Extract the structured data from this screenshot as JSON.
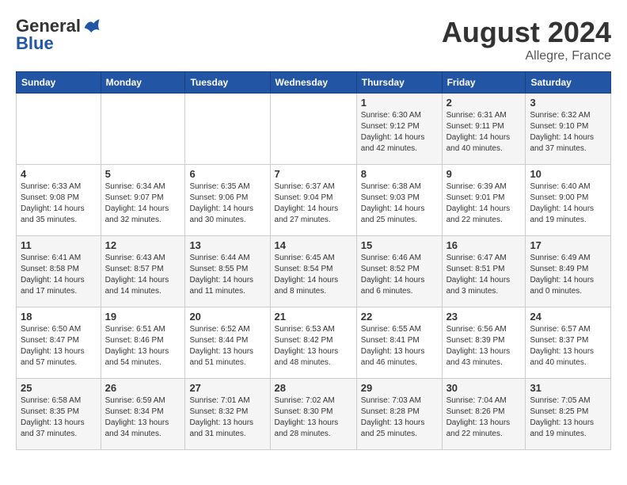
{
  "logo": {
    "general": "General",
    "blue": "Blue"
  },
  "title": "August 2024",
  "location": "Allegre, France",
  "days_of_week": [
    "Sunday",
    "Monday",
    "Tuesday",
    "Wednesday",
    "Thursday",
    "Friday",
    "Saturday"
  ],
  "weeks": [
    [
      {
        "day": "",
        "info": ""
      },
      {
        "day": "",
        "info": ""
      },
      {
        "day": "",
        "info": ""
      },
      {
        "day": "",
        "info": ""
      },
      {
        "day": "1",
        "info": "Sunrise: 6:30 AM\nSunset: 9:12 PM\nDaylight: 14 hours\nand 42 minutes."
      },
      {
        "day": "2",
        "info": "Sunrise: 6:31 AM\nSunset: 9:11 PM\nDaylight: 14 hours\nand 40 minutes."
      },
      {
        "day": "3",
        "info": "Sunrise: 6:32 AM\nSunset: 9:10 PM\nDaylight: 14 hours\nand 37 minutes."
      }
    ],
    [
      {
        "day": "4",
        "info": "Sunrise: 6:33 AM\nSunset: 9:08 PM\nDaylight: 14 hours\nand 35 minutes."
      },
      {
        "day": "5",
        "info": "Sunrise: 6:34 AM\nSunset: 9:07 PM\nDaylight: 14 hours\nand 32 minutes."
      },
      {
        "day": "6",
        "info": "Sunrise: 6:35 AM\nSunset: 9:06 PM\nDaylight: 14 hours\nand 30 minutes."
      },
      {
        "day": "7",
        "info": "Sunrise: 6:37 AM\nSunset: 9:04 PM\nDaylight: 14 hours\nand 27 minutes."
      },
      {
        "day": "8",
        "info": "Sunrise: 6:38 AM\nSunset: 9:03 PM\nDaylight: 14 hours\nand 25 minutes."
      },
      {
        "day": "9",
        "info": "Sunrise: 6:39 AM\nSunset: 9:01 PM\nDaylight: 14 hours\nand 22 minutes."
      },
      {
        "day": "10",
        "info": "Sunrise: 6:40 AM\nSunset: 9:00 PM\nDaylight: 14 hours\nand 19 minutes."
      }
    ],
    [
      {
        "day": "11",
        "info": "Sunrise: 6:41 AM\nSunset: 8:58 PM\nDaylight: 14 hours\nand 17 minutes."
      },
      {
        "day": "12",
        "info": "Sunrise: 6:43 AM\nSunset: 8:57 PM\nDaylight: 14 hours\nand 14 minutes."
      },
      {
        "day": "13",
        "info": "Sunrise: 6:44 AM\nSunset: 8:55 PM\nDaylight: 14 hours\nand 11 minutes."
      },
      {
        "day": "14",
        "info": "Sunrise: 6:45 AM\nSunset: 8:54 PM\nDaylight: 14 hours\nand 8 minutes."
      },
      {
        "day": "15",
        "info": "Sunrise: 6:46 AM\nSunset: 8:52 PM\nDaylight: 14 hours\nand 6 minutes."
      },
      {
        "day": "16",
        "info": "Sunrise: 6:47 AM\nSunset: 8:51 PM\nDaylight: 14 hours\nand 3 minutes."
      },
      {
        "day": "17",
        "info": "Sunrise: 6:49 AM\nSunset: 8:49 PM\nDaylight: 14 hours\nand 0 minutes."
      }
    ],
    [
      {
        "day": "18",
        "info": "Sunrise: 6:50 AM\nSunset: 8:47 PM\nDaylight: 13 hours\nand 57 minutes."
      },
      {
        "day": "19",
        "info": "Sunrise: 6:51 AM\nSunset: 8:46 PM\nDaylight: 13 hours\nand 54 minutes."
      },
      {
        "day": "20",
        "info": "Sunrise: 6:52 AM\nSunset: 8:44 PM\nDaylight: 13 hours\nand 51 minutes."
      },
      {
        "day": "21",
        "info": "Sunrise: 6:53 AM\nSunset: 8:42 PM\nDaylight: 13 hours\nand 48 minutes."
      },
      {
        "day": "22",
        "info": "Sunrise: 6:55 AM\nSunset: 8:41 PM\nDaylight: 13 hours\nand 46 minutes."
      },
      {
        "day": "23",
        "info": "Sunrise: 6:56 AM\nSunset: 8:39 PM\nDaylight: 13 hours\nand 43 minutes."
      },
      {
        "day": "24",
        "info": "Sunrise: 6:57 AM\nSunset: 8:37 PM\nDaylight: 13 hours\nand 40 minutes."
      }
    ],
    [
      {
        "day": "25",
        "info": "Sunrise: 6:58 AM\nSunset: 8:35 PM\nDaylight: 13 hours\nand 37 minutes."
      },
      {
        "day": "26",
        "info": "Sunrise: 6:59 AM\nSunset: 8:34 PM\nDaylight: 13 hours\nand 34 minutes."
      },
      {
        "day": "27",
        "info": "Sunrise: 7:01 AM\nSunset: 8:32 PM\nDaylight: 13 hours\nand 31 minutes."
      },
      {
        "day": "28",
        "info": "Sunrise: 7:02 AM\nSunset: 8:30 PM\nDaylight: 13 hours\nand 28 minutes."
      },
      {
        "day": "29",
        "info": "Sunrise: 7:03 AM\nSunset: 8:28 PM\nDaylight: 13 hours\nand 25 minutes."
      },
      {
        "day": "30",
        "info": "Sunrise: 7:04 AM\nSunset: 8:26 PM\nDaylight: 13 hours\nand 22 minutes."
      },
      {
        "day": "31",
        "info": "Sunrise: 7:05 AM\nSunset: 8:25 PM\nDaylight: 13 hours\nand 19 minutes."
      }
    ]
  ]
}
